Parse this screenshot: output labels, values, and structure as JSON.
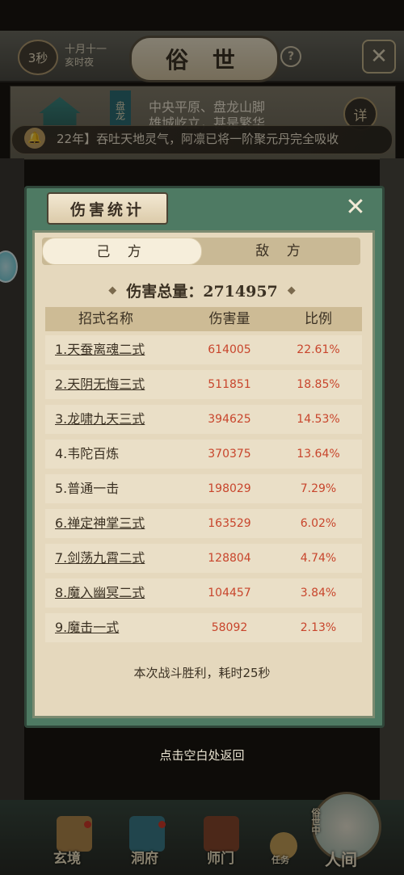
{
  "top_bar": {
    "timer": "3秒",
    "date_line1": "十月十一",
    "date_line2": "亥时夜",
    "title": "俗 世",
    "help_glyph": "?",
    "close_glyph": "✕"
  },
  "location": {
    "banner": "盘龙",
    "line1": "中央平原、盘龙山脚",
    "line2": "雄城屹立，甚是繁华",
    "detail_label": "详"
  },
  "ticker": {
    "text": "22年】吞吐天地灵气，阿凛已将一阶聚元丹完全吸收"
  },
  "dialog": {
    "title": "伤害统计",
    "close_glyph": "✕",
    "tabs": [
      "己 方",
      "敌 方"
    ],
    "active_tab": "己 方",
    "total_label": "伤害总量：2714957",
    "columns": [
      "招式名称",
      "伤害量",
      "比例"
    ],
    "rows": [
      {
        "name": "1.天蚕离魂二式",
        "damage": "614005",
        "ratio": "22.61%",
        "link": true
      },
      {
        "name": "2.天阴无悔三式",
        "damage": "511851",
        "ratio": "18.85%",
        "link": true
      },
      {
        "name": "3.龙啸九天三式",
        "damage": "394625",
        "ratio": "14.53%",
        "link": true
      },
      {
        "name": "4.韦陀百炼",
        "damage": "370375",
        "ratio": "13.64%",
        "link": false
      },
      {
        "name": "5.普通一击",
        "damage": "198029",
        "ratio": "7.29%",
        "link": false
      },
      {
        "name": "6.禅定神掌三式",
        "damage": "163529",
        "ratio": "6.02%",
        "link": true
      },
      {
        "name": "7.剑荡九霄二式",
        "damage": "128804",
        "ratio": "4.74%",
        "link": true
      },
      {
        "name": "8.魔入幽冥二式",
        "damage": "104457",
        "ratio": "3.84%",
        "link": true
      },
      {
        "name": "9.魔击一式",
        "damage": "58092",
        "ratio": "2.13%",
        "link": true
      }
    ],
    "result_text": "本次战斗胜利，耗时25秒"
  },
  "tap_to_return": "点击空白处返回",
  "bottom_nav": {
    "items": [
      "玄境",
      "洞府",
      "师门",
      "任务",
      "人间"
    ],
    "side_label": "俗世中"
  },
  "colors": {
    "accent_red": "#c8452c",
    "dialog_green": "#4e7a63",
    "parchment": "#e5d8bd"
  }
}
